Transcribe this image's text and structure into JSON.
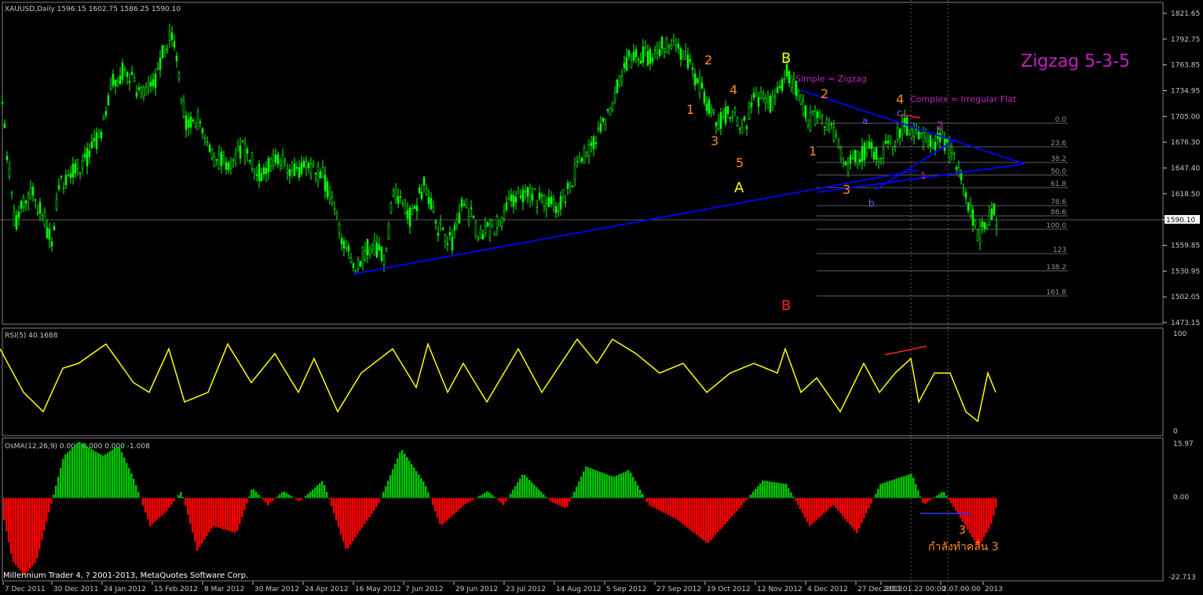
{
  "main_panel": {
    "header": "XAUUSD,Daily  1596.15 1602.75 1586.25 1590.10",
    "y_ticks": [
      "1821.65",
      "1792.75",
      "1763.85",
      "1734.95",
      "1705.00",
      "1676.30",
      "1647.40",
      "1618.50",
      "1589.50",
      "1559.85",
      "1530.95",
      "1502.05",
      "1473.15"
    ],
    "current_price": "1590.10",
    "title_annotation": "Zigzag 5-3-5",
    "notes": {
      "simple": "Simple = Zigzag",
      "complex": "Complex = Irregular Flat"
    },
    "wave_labels": [
      {
        "text": "B",
        "color": "yellow"
      },
      {
        "text": "A",
        "color": "yellow"
      },
      {
        "text": "B",
        "color": "red"
      },
      {
        "text": "1",
        "color": "orange"
      },
      {
        "text": "2",
        "color": "orange"
      },
      {
        "text": "3",
        "color": "orange"
      },
      {
        "text": "4",
        "color": "orange"
      },
      {
        "text": "5",
        "color": "orange"
      },
      {
        "text": "1",
        "color": "orange"
      },
      {
        "text": "2",
        "color": "orange"
      },
      {
        "text": "3",
        "color": "orange"
      },
      {
        "text": "4",
        "color": "orange"
      },
      {
        "text": "a",
        "color": "blue"
      },
      {
        "text": "b",
        "color": "blue"
      },
      {
        "text": "c",
        "color": "blue"
      },
      {
        "text": "1",
        "color": "magenta"
      },
      {
        "text": "2",
        "color": "magenta"
      }
    ],
    "fib_levels": [
      "0.0",
      "23.6",
      "38.2",
      "50.0",
      "61.8",
      "78.6",
      "88.6",
      "100.0",
      "123",
      "138.2",
      "161.8"
    ]
  },
  "rsi_panel": {
    "header": "RSI(5) 40.1688",
    "y_ticks": [
      "100",
      "0"
    ]
  },
  "osma_panel": {
    "header": "OsMA(12,26,9) 0.000 0.000 0.000 -1.008",
    "y_ticks": [
      "15.97",
      "0.00",
      "-22.713"
    ],
    "wave_label": "3",
    "thai_note": "กำลังทำคลื่น 3"
  },
  "footer": {
    "copyright": "Millennium Trader 4, ? 2001-2013, MetaQuotes Software Corp.",
    "x_ticks": [
      "7 Dec 2011",
      "30 Dec 2011",
      "24 Jan 2012",
      "15 Feb 2012",
      "8 Mar 2012",
      "30 Mar 2012",
      "24 Apr 2012",
      "16 May 2012",
      "7 Jun 2012",
      "29 Jun 2012",
      "23 Jul 2012",
      "14 Aug 2012",
      "5 Sep 2012",
      "27 Sep 2012",
      "19 Oct 2012",
      "12 Nov 2012",
      "4 Dec 2012",
      "27 Dec 2012",
      "2013.01.22 00:00",
      "2.07.00:00",
      "2013"
    ]
  },
  "colors": {
    "bg": "#000000",
    "candle": "#00ff00",
    "trendline": "#0000ff",
    "rsi_line": "#ffff00",
    "osma_up": "#00c000",
    "osma_down": "#ff0000",
    "label_orange": "#ff8c1a",
    "label_yellow": "#ffff00",
    "label_red": "#ff2020",
    "label_blue": "#5070ff",
    "label_magenta": "#d020d0",
    "grid_text": "#c8c8c8"
  },
  "chart_data": {
    "type": "candlestick",
    "symbol": "XAUUSD",
    "timeframe": "Daily",
    "last_bar": {
      "open": 1596.15,
      "high": 1602.75,
      "low": 1586.25,
      "close": 1590.1
    },
    "price_path": [
      [
        0,
        1740
      ],
      [
        8,
        1660
      ],
      [
        18,
        1580
      ],
      [
        28,
        1610
      ],
      [
        40,
        1620
      ],
      [
        55,
        1590
      ],
      [
        65,
        1560
      ],
      [
        75,
        1630
      ],
      [
        90,
        1640
      ],
      [
        110,
        1660
      ],
      [
        125,
        1680
      ],
      [
        140,
        1740
      ],
      [
        160,
        1760
      ],
      [
        175,
        1730
      ],
      [
        195,
        1740
      ],
      [
        210,
        1790
      ],
      [
        220,
        1790
      ],
      [
        235,
        1700
      ],
      [
        255,
        1700
      ],
      [
        270,
        1660
      ],
      [
        290,
        1650
      ],
      [
        310,
        1670
      ],
      [
        330,
        1640
      ],
      [
        350,
        1660
      ],
      [
        370,
        1640
      ],
      [
        390,
        1650
      ],
      [
        410,
        1640
      ],
      [
        430,
        1580
      ],
      [
        450,
        1535
      ],
      [
        470,
        1560
      ],
      [
        490,
        1545
      ],
      [
        500,
        1620
      ],
      [
        520,
        1590
      ],
      [
        540,
        1630
      ],
      [
        555,
        1580
      ],
      [
        575,
        1565
      ],
      [
        590,
        1610
      ],
      [
        610,
        1570
      ],
      [
        630,
        1580
      ],
      [
        650,
        1610
      ],
      [
        670,
        1620
      ],
      [
        690,
        1610
      ],
      [
        710,
        1600
      ],
      [
        730,
        1640
      ],
      [
        750,
        1670
      ],
      [
        770,
        1700
      ],
      [
        785,
        1740
      ],
      [
        800,
        1770
      ],
      [
        830,
        1775
      ],
      [
        850,
        1790
      ],
      [
        865,
        1780
      ],
      [
        885,
        1750
      ],
      [
        900,
        1720
      ],
      [
        915,
        1700
      ],
      [
        930,
        1715
      ],
      [
        945,
        1690
      ],
      [
        960,
        1725
      ],
      [
        985,
        1720
      ],
      [
        1000,
        1755
      ],
      [
        1015,
        1735
      ],
      [
        1030,
        1700
      ],
      [
        1045,
        1710
      ],
      [
        1060,
        1685
      ],
      [
        1075,
        1650
      ],
      [
        1090,
        1660
      ],
      [
        1105,
        1670
      ],
      [
        1120,
        1665
      ],
      [
        1135,
        1675
      ],
      [
        1150,
        1695
      ],
      [
        1165,
        1690
      ],
      [
        1180,
        1675
      ],
      [
        1200,
        1680
      ],
      [
        1215,
        1660
      ],
      [
        1225,
        1630
      ],
      [
        1235,
        1600
      ],
      [
        1245,
        1570
      ],
      [
        1255,
        1590
      ],
      [
        1265,
        1600
      ],
      [
        1268,
        1590
      ]
    ],
    "rsi_path": [
      [
        0,
        85
      ],
      [
        30,
        40
      ],
      [
        55,
        20
      ],
      [
        80,
        65
      ],
      [
        100,
        70
      ],
      [
        135,
        90
      ],
      [
        170,
        50
      ],
      [
        190,
        40
      ],
      [
        215,
        85
      ],
      [
        235,
        30
      ],
      [
        265,
        40
      ],
      [
        290,
        90
      ],
      [
        320,
        50
      ],
      [
        350,
        80
      ],
      [
        380,
        40
      ],
      [
        400,
        75
      ],
      [
        430,
        20
      ],
      [
        460,
        60
      ],
      [
        500,
        85
      ],
      [
        530,
        45
      ],
      [
        545,
        90
      ],
      [
        570,
        40
      ],
      [
        590,
        70
      ],
      [
        620,
        30
      ],
      [
        660,
        85
      ],
      [
        690,
        40
      ],
      [
        735,
        95
      ],
      [
        760,
        70
      ],
      [
        780,
        95
      ],
      [
        810,
        80
      ],
      [
        840,
        60
      ],
      [
        870,
        70
      ],
      [
        900,
        40
      ],
      [
        930,
        60
      ],
      [
        960,
        70
      ],
      [
        990,
        60
      ],
      [
        1000,
        85
      ],
      [
        1020,
        40
      ],
      [
        1040,
        55
      ],
      [
        1070,
        20
      ],
      [
        1100,
        70
      ],
      [
        1120,
        40
      ],
      [
        1140,
        60
      ],
      [
        1160,
        75
      ],
      [
        1170,
        30
      ],
      [
        1190,
        60
      ],
      [
        1210,
        60
      ],
      [
        1230,
        20
      ],
      [
        1245,
        10
      ],
      [
        1258,
        60
      ],
      [
        1268,
        40
      ]
    ],
    "osma_path": [
      [
        0,
        -2
      ],
      [
        15,
        -18
      ],
      [
        30,
        -22
      ],
      [
        45,
        -18
      ],
      [
        60,
        -5
      ],
      [
        80,
        12
      ],
      [
        100,
        16
      ],
      [
        130,
        12
      ],
      [
        150,
        15
      ],
      [
        170,
        5
      ],
      [
        190,
        -8
      ],
      [
        210,
        -4
      ],
      [
        230,
        2
      ],
      [
        250,
        -15
      ],
      [
        270,
        -8
      ],
      [
        300,
        -10
      ],
      [
        320,
        3
      ],
      [
        340,
        -2
      ],
      [
        360,
        2
      ],
      [
        380,
        -1
      ],
      [
        410,
        5
      ],
      [
        440,
        -15
      ],
      [
        455,
        -10
      ],
      [
        480,
        -2
      ],
      [
        510,
        14
      ],
      [
        540,
        4
      ],
      [
        560,
        -8
      ],
      [
        590,
        -2
      ],
      [
        620,
        2
      ],
      [
        640,
        -2
      ],
      [
        665,
        7
      ],
      [
        700,
        -1
      ],
      [
        720,
        -3
      ],
      [
        745,
        9
      ],
      [
        780,
        6
      ],
      [
        800,
        8
      ],
      [
        825,
        -2
      ],
      [
        860,
        -6
      ],
      [
        900,
        -13
      ],
      [
        940,
        -3
      ],
      [
        970,
        5
      ],
      [
        1000,
        4
      ],
      [
        1030,
        -8
      ],
      [
        1060,
        -2
      ],
      [
        1090,
        -10
      ],
      [
        1120,
        4
      ],
      [
        1160,
        7
      ],
      [
        1175,
        -2
      ],
      [
        1200,
        2
      ],
      [
        1220,
        -5
      ],
      [
        1245,
        -14
      ],
      [
        1260,
        -8
      ],
      [
        1268,
        -2
      ]
    ],
    "triangle_lines": [
      {
        "from": [
          1020,
          1735
        ],
        "to": [
          1305,
          1652
        ]
      },
      {
        "from": [
          1040,
          1620
        ],
        "to": [
          1305,
          1652
        ]
      },
      {
        "from": [
          1115,
          1623
        ],
        "to": [
          1218,
          1680
        ]
      }
    ],
    "support_line": {
      "from": [
        450,
        1528
      ],
      "to": [
        1170,
        1645
      ]
    },
    "price_range": [
      1473.15,
      1821.65
    ],
    "rsi_range": [
      0,
      100
    ],
    "osma_range": [
      -22.713,
      15.97
    ]
  }
}
